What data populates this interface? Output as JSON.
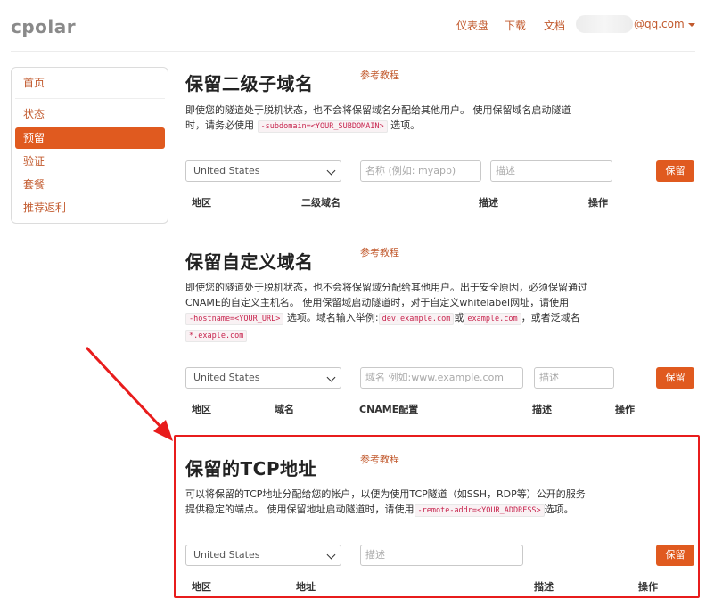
{
  "header": {
    "logo": "cpolar",
    "nav": [
      "仪表盘",
      "下载",
      "文档"
    ],
    "email": "@qq.com"
  },
  "sidebar": {
    "items": [
      {
        "label": "首页"
      },
      {
        "label": "状态"
      },
      {
        "label": "预留"
      },
      {
        "label": "验证"
      },
      {
        "label": "套餐"
      },
      {
        "label": "推荐返利"
      }
    ]
  },
  "sections": [
    {
      "title": "保留二级子域名",
      "ref": "参考教程",
      "desc_line1": "即使您的隧道处于脱机状态，也不会将保留域名分配给其他用户。 使用保留域名启动隧道",
      "desc_line2_pre": "时，请务必使用",
      "desc_code1": "-subdomain=<YOUR_SUBDOMAIN>",
      "desc_line2_post": "选项。",
      "region": "United States",
      "name_placeholder": "名称 (例如: myapp)",
      "desc_placeholder": "描述",
      "button": "保留",
      "headers": [
        "地区",
        "二级域名",
        "描述",
        "操作"
      ]
    },
    {
      "title": "保留自定义域名",
      "ref": "参考教程",
      "desc_line1": "即使您的隧道处于脱机状态，也不会将保留域分配给其他用户。出于安全原因，必须保留通过",
      "desc_line2": "CNAME的自定义主机名。 使用保留域启动隧道时，对于自定义whitelabel网址，请使用",
      "desc_code1": "-hostname=<YOUR_URL>",
      "desc_line3_mid": "选项。域名输入举例:",
      "desc_code2": "dev.example.com",
      "desc_or": "或",
      "desc_code3": "example.com",
      "desc_line3_post": "，或者泛域名",
      "desc_code4": "*.exaple.com",
      "region": "United States",
      "domain_placeholder": "域名 例如:www.example.com",
      "desc_placeholder": "描述",
      "button": "保留",
      "headers": [
        "地区",
        "域名",
        "CNAME配置",
        "描述",
        "操作"
      ]
    },
    {
      "title": "保留的TCP地址",
      "ref": "参考教程",
      "desc_line1": "可以将保留的TCP地址分配给您的帐户，以便为使用TCP隧道（如SSH，RDP等）公开的服务",
      "desc_line2_pre": "提供稳定的端点。 使用保留地址启动隧道时，请使用",
      "desc_code1": "-remote-addr=<YOUR_ADDRESS>",
      "desc_line2_post": "选项。",
      "region": "United States",
      "desc_placeholder": "描述",
      "button": "保留",
      "headers": [
        "地区",
        "地址",
        "描述",
        "操作"
      ]
    }
  ],
  "colors": {
    "accent": "#e05a1f",
    "link": "#c25a2e",
    "highlight": "#e81c1c"
  }
}
